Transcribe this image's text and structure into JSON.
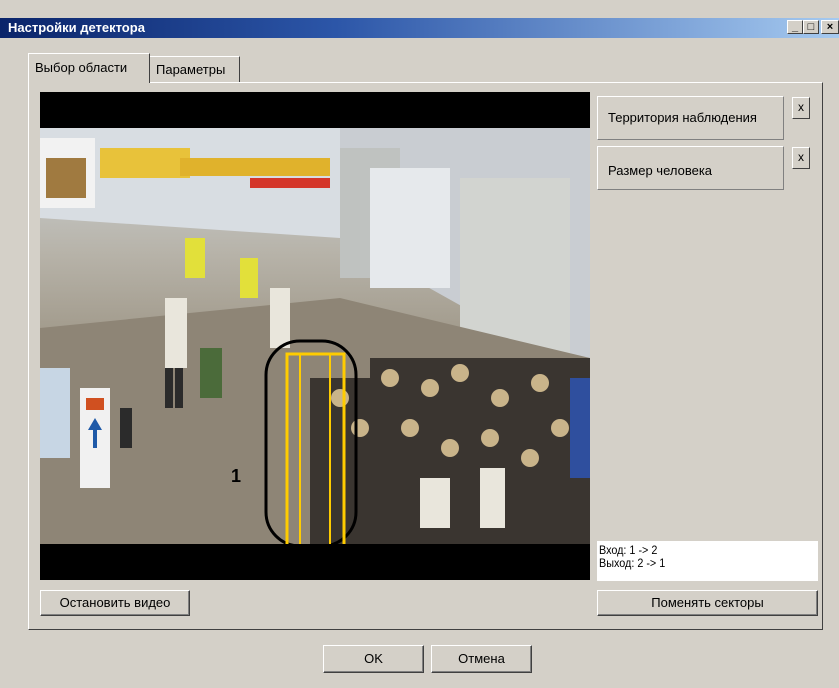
{
  "window": {
    "title": "Настройки детектора",
    "controls": {
      "minimize": "_",
      "maximize": "□",
      "close": "×"
    }
  },
  "tabs": [
    {
      "label": "Выбор области",
      "active": true
    },
    {
      "label": "Параметры",
      "active": false
    }
  ],
  "video": {
    "zone_label": "1"
  },
  "zones": [
    {
      "label": "Территория наблюдения",
      "remove_label": "x"
    },
    {
      "label": "Размер человека",
      "remove_label": "x"
    }
  ],
  "info": {
    "entry": "Вход: 1 -> 2",
    "exit": "Выход: 2 -> 1"
  },
  "buttons": {
    "stop_video": "Остановить видео",
    "swap_sectors": "Поменять секторы",
    "ok": "OK",
    "cancel": "Отмена"
  },
  "colors": {
    "title_start": "#0a246a",
    "title_end": "#a6caf0",
    "face": "#d4d0c8",
    "zone_yellow": "#ffcc00"
  }
}
